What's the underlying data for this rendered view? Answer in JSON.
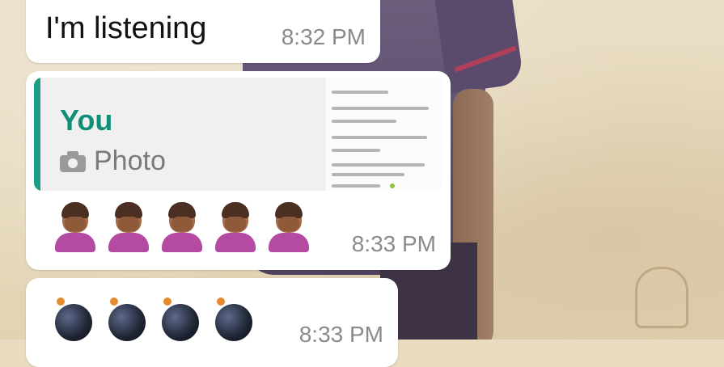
{
  "messages": [
    {
      "text": "I'm listening",
      "time": "8:32 PM"
    },
    {
      "quote": {
        "author": "You",
        "type_label": "Photo",
        "icon": "camera-icon"
      },
      "emoji": [
        "facepalm",
        "facepalm",
        "facepalm",
        "facepalm",
        "facepalm"
      ],
      "time": "8:33 PM"
    },
    {
      "emoji": [
        "bomb",
        "bomb",
        "bomb",
        "bomb"
      ],
      "time": "8:33 PM"
    }
  ],
  "colors": {
    "quote_accent": "#1a9e85",
    "quote_author": "#0f8f78",
    "bubble": "#ffffff",
    "time": "#8a8a8a"
  }
}
